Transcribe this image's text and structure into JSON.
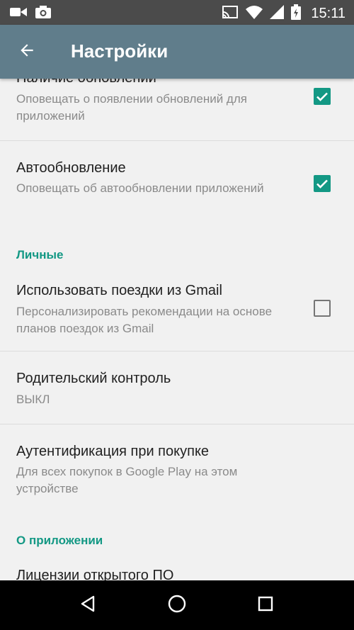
{
  "status_bar": {
    "time": "15:11",
    "icons": [
      "video-camera-icon",
      "camera-icon",
      "cast-icon",
      "wifi-icon",
      "signal-icon",
      "battery-icon"
    ]
  },
  "app_bar": {
    "title": "Настройки",
    "back_icon": "arrow-left-icon"
  },
  "settings": [
    {
      "title": "Наличие обновлений",
      "subtitle": "Оповещать о появлении обновлений для приложений",
      "checked": true
    },
    {
      "title": "Автообновление",
      "subtitle": "Оповещать об автообновлении приложений",
      "checked": true
    },
    {
      "section": "Личные"
    },
    {
      "title": "Использовать поездки из Gmail",
      "subtitle": "Персонализировать рекомендации на основе планов поездок из Gmail",
      "checked": false
    },
    {
      "title": "Родительский контроль",
      "subtitle": "ВЫКЛ"
    },
    {
      "title": "Аутентификация при покупке",
      "subtitle": "Для всех покупок в Google Play на этом устройстве"
    },
    {
      "section": "О приложении"
    },
    {
      "title": "Лицензии открытого ПО"
    }
  ],
  "nav_bar": {
    "icons": [
      "back-triangle-icon",
      "home-circle-icon",
      "recents-square-icon"
    ]
  },
  "colors": {
    "app_bar": "#607d8b",
    "accent": "#139884",
    "status_bar": "#4b4b4b",
    "nav_bar": "#000000"
  }
}
